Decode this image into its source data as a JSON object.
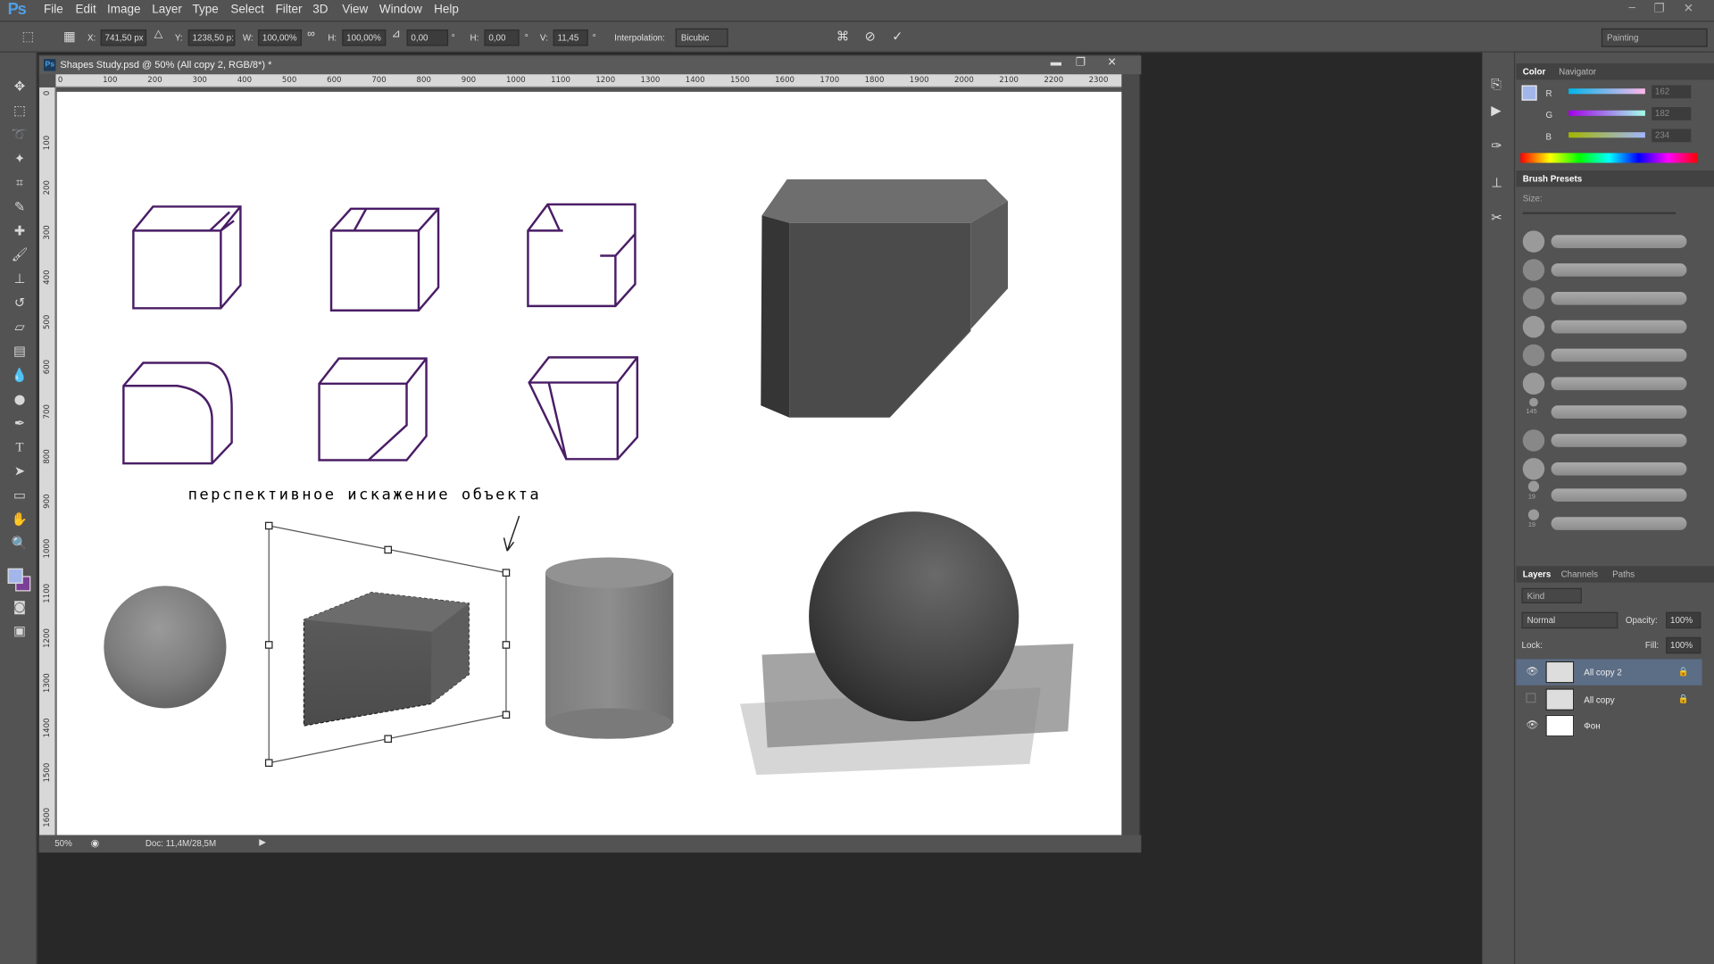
{
  "app": {
    "logo": "Ps"
  },
  "menu": [
    "File",
    "Edit",
    "Image",
    "Layer",
    "Type",
    "Select",
    "Filter",
    "3D",
    "View",
    "Window",
    "Help"
  ],
  "options": {
    "x_label": "X:",
    "x_value": "741,50 px",
    "y_label": "Y:",
    "y_value": "1238,50 p:",
    "w_label": "W:",
    "w_value": "100,00%",
    "h_label": "H:",
    "h_value": "100,00%",
    "angle_value": "0,00",
    "hskew_label": "H:",
    "hskew_value": "0,00",
    "vskew_label": "V:",
    "vskew_value": "11,45",
    "interp_label": "Interpolation:",
    "interp_value": "Bicubic",
    "workspace": "Painting"
  },
  "document": {
    "title": "Shapes Study.psd @ 50% (All copy 2, RGB/8*) *",
    "ruler_h": [
      "0",
      "100",
      "200",
      "300",
      "400",
      "500",
      "600",
      "700",
      "800",
      "900",
      "1000",
      "1100",
      "1200",
      "1300",
      "1400",
      "1500",
      "1600",
      "1700",
      "1800",
      "1900",
      "2000",
      "2100",
      "2200",
      "2300"
    ],
    "ruler_v": [
      "0",
      "100",
      "200",
      "300",
      "400",
      "500",
      "600",
      "700",
      "800",
      "900",
      "1000",
      "1100",
      "1200",
      "1300",
      "1400",
      "1500",
      "1600"
    ],
    "handwritten": "перспективное искажение объекта",
    "zoom": "50%",
    "doc_size": "Doc: 11,4M/28,5M"
  },
  "color_panel": {
    "tabs": [
      "Color",
      "Navigator"
    ],
    "channels": [
      {
        "label": "R",
        "value": "162"
      },
      {
        "label": "G",
        "value": "182"
      },
      {
        "label": "B",
        "value": "234"
      }
    ],
    "fg_color": "#a2b6ea",
    "bg_color": "#7b3f96"
  },
  "brush_panel": {
    "title": "Brush Presets",
    "size_label": "Size:",
    "numbers": [
      "145",
      "19",
      "19"
    ]
  },
  "layers_panel": {
    "tabs": [
      "Layers",
      "Channels",
      "Paths"
    ],
    "kind": "Kind",
    "blend": "Normal",
    "opacity_label": "Opacity:",
    "opacity": "100%",
    "lock_label": "Lock:",
    "fill_label": "Fill:",
    "fill": "100%",
    "layers": [
      {
        "name": "All copy 2",
        "visible": true,
        "selected": true
      },
      {
        "name": "All copy",
        "visible": false,
        "selected": false
      },
      {
        "name": "Фон",
        "visible": true,
        "selected": false
      }
    ]
  }
}
